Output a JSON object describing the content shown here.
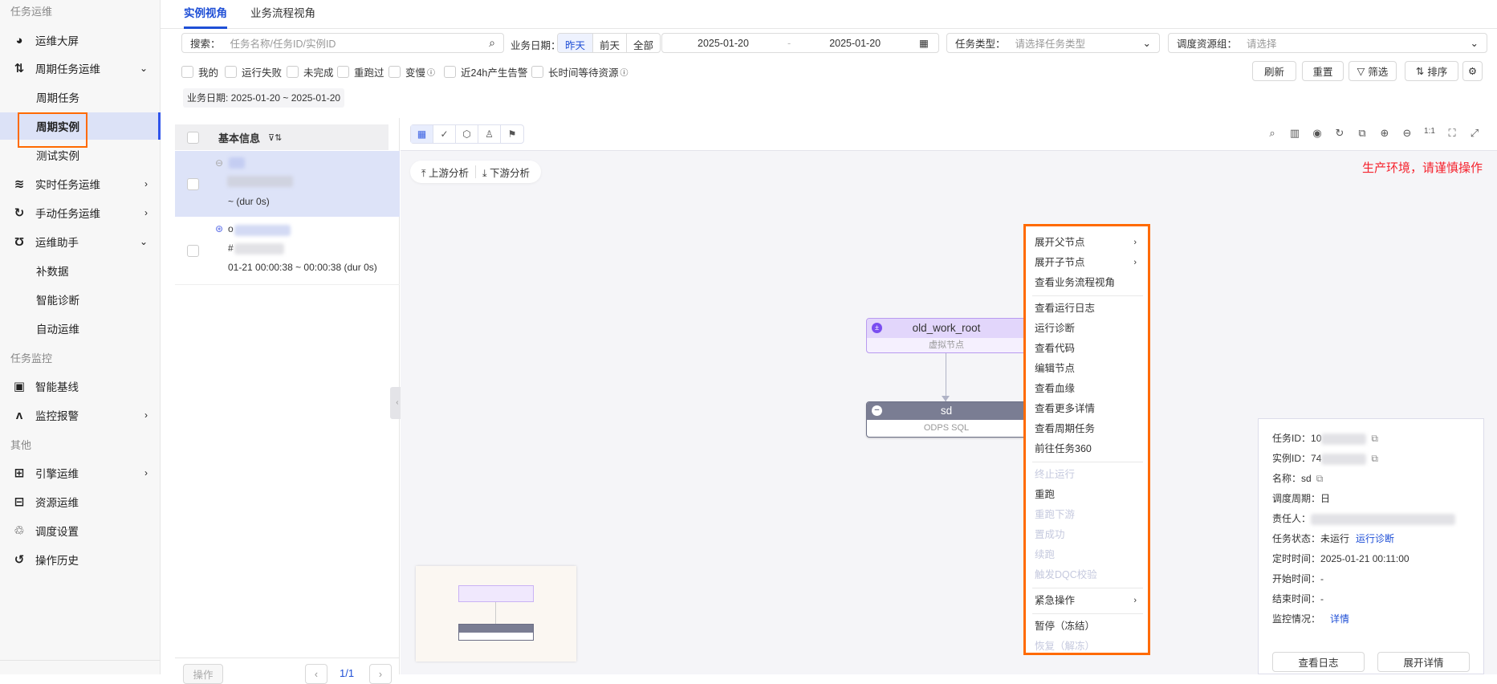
{
  "sidebar": {
    "sections": [
      "任务运维",
      "任务监控",
      "其他"
    ],
    "items": [
      {
        "label": "运维大屏",
        "icon": "pie-chart-icon"
      },
      {
        "label": "周期任务运维",
        "icon": "cycle-icon"
      },
      {
        "label": "周期任务"
      },
      {
        "label": "周期实例"
      },
      {
        "label": "测试实例"
      },
      {
        "label": "实时任务运维",
        "icon": "stream-icon"
      },
      {
        "label": "手动任务运维",
        "icon": "manual-icon"
      },
      {
        "label": "运维助手",
        "icon": "stethoscope-icon"
      },
      {
        "label": "补数据"
      },
      {
        "label": "智能诊断"
      },
      {
        "label": "自动运维"
      },
      {
        "label": "智能基线",
        "icon": "baseline-icon"
      },
      {
        "label": "监控报警",
        "icon": "pulse-icon"
      },
      {
        "label": "引擎运维",
        "icon": "chip-icon"
      },
      {
        "label": "资源运维",
        "icon": "resource-icon"
      },
      {
        "label": "调度设置",
        "icon": "schedule-icon"
      },
      {
        "label": "操作历史",
        "icon": "history-icon"
      }
    ]
  },
  "tabs": [
    "实例视角",
    "业务流程视角"
  ],
  "filters": {
    "search_label": "搜索：",
    "search_placeholder": "任务名称/任务ID/实例ID",
    "date_label": "业务日期：",
    "date_options": [
      "昨天",
      "前天",
      "全部"
    ],
    "date_start": "2025-01-20",
    "date_end": "2025-01-20",
    "task_type_label": "任务类型：",
    "task_type_placeholder": "请选择任务类型",
    "resource_label": "调度资源组：",
    "resource_placeholder": "请选择",
    "checks": [
      "我的",
      "运行失败",
      "未完成",
      "重跑过",
      "变慢",
      "近24h产生告警",
      "长时间等待资源"
    ],
    "buttons": {
      "refresh": "刷新",
      "reset": "重置",
      "filter": "筛选",
      "sort": "排序"
    },
    "date_tag": "业务日期: 2025-01-20 ~ 2025-01-20"
  },
  "list": {
    "header": "基本信息",
    "rows": [
      {
        "time": "~ (dur 0s)"
      },
      {
        "name_prefix": "o",
        "id_prefix": "#",
        "time": "01-21 00:00:38 ~ 00:00:38 (dur 0s)"
      }
    ],
    "op_button": "操作",
    "page": "1/1"
  },
  "graph": {
    "upstream": "上游分析",
    "downstream": "下游分析",
    "warning": "生产环境，请谨慎操作",
    "warning_color": "#f5222d",
    "nodes": [
      {
        "name": "old_work_root",
        "type": "虚拟节点"
      },
      {
        "name": "sd",
        "type": "ODPS SQL"
      }
    ]
  },
  "context_menu": [
    {
      "label": "展开父节点",
      "submenu": true
    },
    {
      "label": "展开子节点",
      "submenu": true
    },
    {
      "label": "查看业务流程视角"
    },
    {
      "sep": true
    },
    {
      "label": "查看运行日志"
    },
    {
      "label": "运行诊断"
    },
    {
      "label": "查看代码"
    },
    {
      "label": "编辑节点"
    },
    {
      "label": "查看血缘"
    },
    {
      "label": "查看更多详情"
    },
    {
      "label": "查看周期任务"
    },
    {
      "label": "前往任务360"
    },
    {
      "sep": true
    },
    {
      "label": "终止运行",
      "disabled": true
    },
    {
      "label": "重跑"
    },
    {
      "label": "重跑下游",
      "disabled": true
    },
    {
      "label": "置成功",
      "disabled": true
    },
    {
      "label": "续跑",
      "disabled": true
    },
    {
      "label": "触发DQC校验",
      "disabled": true
    },
    {
      "sep": true
    },
    {
      "label": "紧急操作",
      "submenu": true
    },
    {
      "sep": true
    },
    {
      "label": "暂停（冻结）"
    },
    {
      "label": "恢复（解冻）",
      "disabled": true
    }
  ],
  "detail": {
    "task_id_label": "任务ID：",
    "task_id_prefix": "10",
    "instance_id_label": "实例ID：",
    "instance_id_prefix": "74",
    "name_label": "名称：",
    "name": "sd",
    "cycle_label": "调度周期：",
    "cycle": "日",
    "owner_label": "责任人：",
    "status_label": "任务状态：",
    "status": "未运行",
    "diagnose": "运行诊断",
    "timer_label": "定时时间：",
    "timer": "2025-01-21 00:11:00",
    "start_label": "开始时间：",
    "start": "-",
    "end_label": "结束时间：",
    "end": "-",
    "monitor_label": "监控情况：",
    "monitor": "详情",
    "view_log": "查看日志",
    "expand": "展开详情"
  }
}
